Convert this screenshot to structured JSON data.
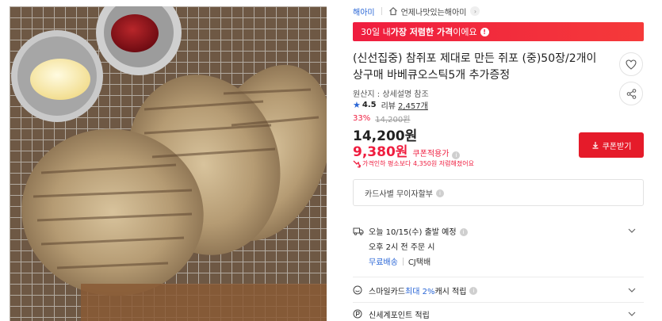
{
  "header": {
    "store_name": "해아미",
    "shop_link": "언제나맛있는해아미",
    "shop_chevron": "›"
  },
  "banner": {
    "prefix": "30일 내 ",
    "highlight": "가장 저렴한 가격",
    "suffix": "이에요",
    "icon": "!"
  },
  "product": {
    "title": "(신선집중) 참쥐포 제대로 만든 쥐포 (중)50장/2개이상구매 바베큐오스틱5개 추가증정",
    "origin": "원산지 : 상세설명 참조",
    "rating": "4.5",
    "review_label": "리뷰",
    "review_count": "2,457개"
  },
  "price": {
    "discount_rate": "33%",
    "original_price": "14,200원",
    "sale_price": "14,200원",
    "coupon_price": "9,380원",
    "coupon_label": "쿠폰적용가",
    "drop_text": "가격인하 평소보다 4,350원 저렴해졌어요",
    "info_icon": "i"
  },
  "buttons": {
    "coupon": "쿠폰받기"
  },
  "card": {
    "label": "카드사별 무이자할부",
    "info_icon": "i"
  },
  "shipping": {
    "line1": "오늘 10/15(수) 출발 예정",
    "line2": "오후 2시 전 주문 시",
    "free": "무료배송",
    "courier": "CJ택배",
    "info_icon": "i"
  },
  "smile": {
    "prefix": "스마일카드 ",
    "highlight": "최대 2%",
    "suffix": " 캐시 적립",
    "info_icon": "i"
  },
  "points": {
    "label": "신세계포인트 적립"
  },
  "colors": {
    "accent_red": "#ef1d3f",
    "link_blue": "#2a66d6"
  }
}
